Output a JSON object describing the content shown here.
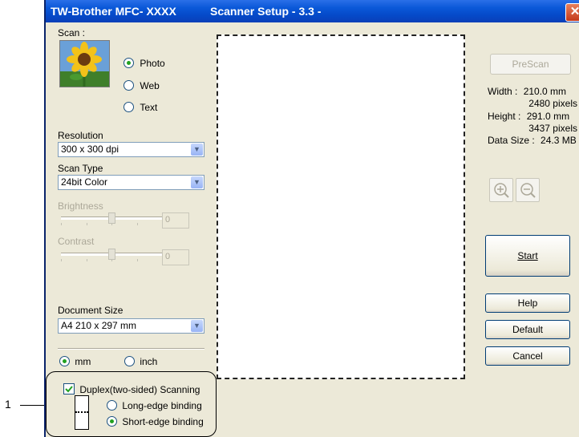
{
  "callout": {
    "number": "1"
  },
  "window": {
    "app_title": "TW-Brother MFC-  XXXX",
    "dialog_title": "Scanner Setup - 3.3 -",
    "close_glyph": "✕"
  },
  "scan": {
    "label": "Scan :",
    "options": [
      "Photo",
      "Web",
      "Text"
    ],
    "selected": "Photo"
  },
  "resolution": {
    "label": "Resolution",
    "value": "300 x 300 dpi"
  },
  "scan_type": {
    "label": "Scan Type",
    "value": "24bit Color"
  },
  "brightness": {
    "label": "Brightness",
    "value": "0"
  },
  "contrast": {
    "label": "Contrast",
    "value": "0"
  },
  "document_size": {
    "label": "Document Size",
    "value": "A4 210 x 297 mm"
  },
  "units": {
    "options": [
      "mm",
      "inch"
    ],
    "selected": "mm"
  },
  "duplex": {
    "checkbox_label": "Duplex(two-sided) Scanning",
    "checked": true,
    "options": [
      "Long-edge binding",
      "Short-edge binding"
    ],
    "selected": "Short-edge binding"
  },
  "right_panel": {
    "prescan_label": "PreScan",
    "width_label": "Width :",
    "width_mm": "210.0 mm",
    "width_px": "2480 pixels",
    "height_label": "Height :",
    "height_mm": "291.0 mm",
    "height_px": "3437 pixels",
    "data_size_label": "Data Size :",
    "data_size_value": "24.3 MB",
    "start_label": "Start",
    "help_label": "Help",
    "default_label": "Default",
    "cancel_label": "Cancel"
  },
  "icons": {
    "zoom_in": "zoom-in-icon",
    "zoom_out": "zoom-out-icon",
    "scan_photo": "sunflower-photo-icon",
    "binding": "binding-icon"
  },
  "colors": {
    "title_bar": "#0549c8",
    "window_bg": "#ece9d8",
    "radio_dot": "#21a121"
  }
}
